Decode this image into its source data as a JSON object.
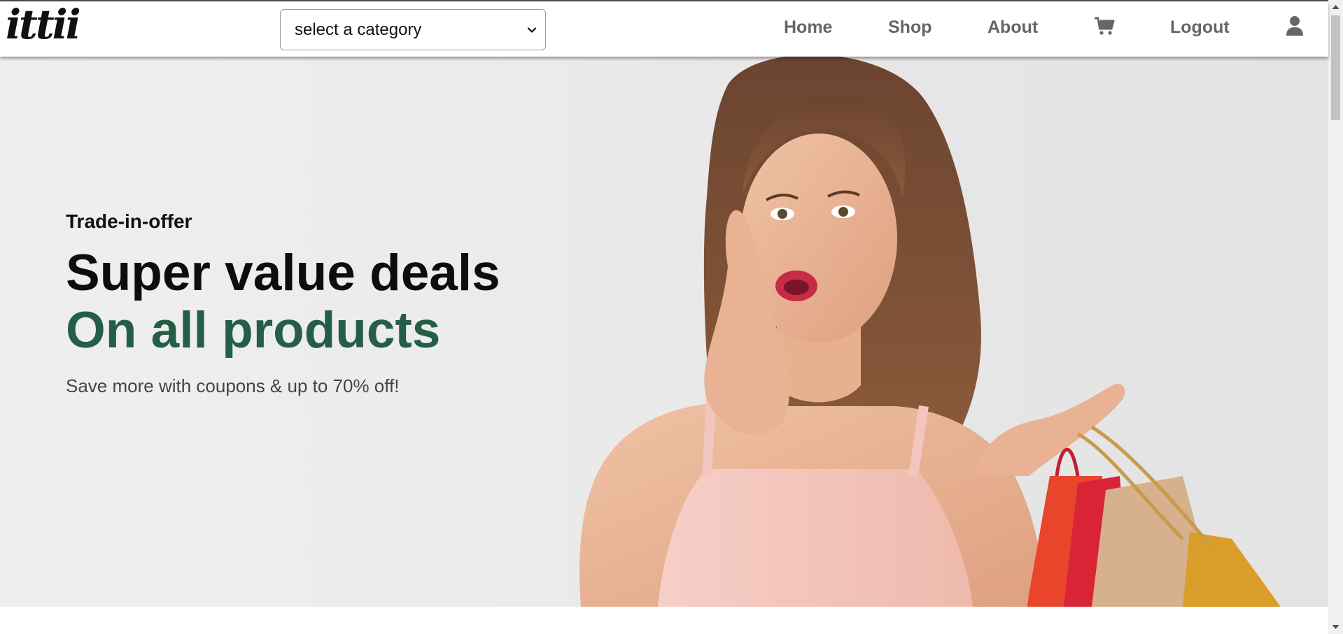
{
  "header": {
    "logo_text": "ittii",
    "category_select": {
      "selected": "select a category"
    },
    "nav": {
      "home": "Home",
      "shop": "Shop",
      "about": "About",
      "logout": "Logout"
    },
    "icons": [
      "cart-icon",
      "user-icon"
    ]
  },
  "hero": {
    "tag": "Trade-in-offer",
    "title": "Super value deals",
    "title_accent": "On all products",
    "subtitle": "Save more with coupons & up to 70% off!"
  },
  "colors": {
    "accent_green": "#245e46",
    "nav_gray": "#666666",
    "hero_bg": "#ebebeb"
  }
}
